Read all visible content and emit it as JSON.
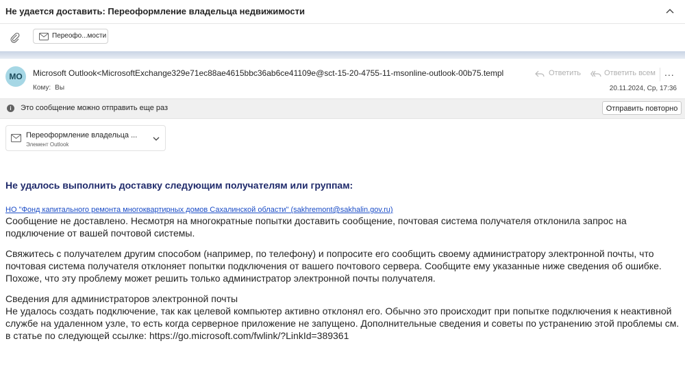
{
  "subject": "Не удается доставить: Переоформление владельца недвижимости",
  "attachment_chip": {
    "label": "Переофо...мости"
  },
  "header": {
    "avatar_initials": "МО",
    "sender": "Microsoft Outlook<MicrosoftExchange329e71ec88ae4615bbc36ab6ce41109e@sct-15-20-4755-11-msonline-outlook-00b75.templ",
    "to_label": "Кому:",
    "to_value": "Вы",
    "reply_label": "Ответить",
    "reply_all_label": "Ответить всем",
    "more_label": "...",
    "date": "20.11.2024, Ср, 17:36"
  },
  "notice": {
    "text": "Это сообщение можно отправить еще раз",
    "resend_label": "Отправить повторно"
  },
  "attachment_card": {
    "name": "Переоформление владельца ...",
    "type": "Элемент Outlook"
  },
  "body": {
    "heading": "Не удалось выполнить доставку следующим получателям или группам:",
    "recipient": "НО \"Фонд капитального ремонта многоквартирных домов Сахалинской области\" (sakhremont@sakhalin.gov.ru)",
    "p1": "Сообщение не доставлено. Несмотря на многократные попытки доставить сообщение, почтовая система получателя отклонила запрос на подключение от вашей почтовой системы.",
    "p2": "Свяжитесь с получателем другим способом (например, по телефону) и попросите его сообщить своему администратору электронной почты, что почтовая система получателя отклоняет попытки подключения от вашего почтового сервера. Сообщите ему указанные ниже сведения об ошибке. Похоже, что эту проблему может решить только администратор электронной почты получателя.",
    "admin_title": "Сведения для администраторов электронной почты",
    "admin_text": "Не удалось создать подключение, так как целевой компьютер активно отклонял его. Обычно это происходит при попытке подключения к неактивной службе на удаленном узле, то есть когда серверное приложение не запущено. Дополнительные сведения и советы по устранению этой проблемы см. в статье по следующей ссылке: https://go.microsoft.com/fwlink/?LinkId=389361"
  }
}
